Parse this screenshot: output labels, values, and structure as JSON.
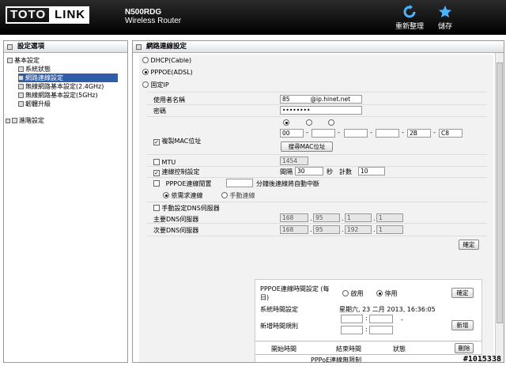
{
  "header": {
    "brand_left": "TOTO",
    "brand_right": "LINK",
    "model": "N500RDG",
    "product": "Wireless Router",
    "reload_label": "重新整理",
    "save_label": "儲存"
  },
  "sidebar": {
    "title": "設定選項",
    "items": [
      {
        "label": "基本設定"
      },
      {
        "label": "系統狀態"
      },
      {
        "label": "網路連線設定"
      },
      {
        "label": "無線網路基本設定(2.4GHz)"
      },
      {
        "label": "無線網路基本設定(5GHz)"
      },
      {
        "label": "韌體升級"
      },
      {
        "label": "進階設定"
      }
    ]
  },
  "main": {
    "title": "網路連線設定",
    "modes": [
      "DHCP(Cable)",
      "PPPOE(ADSL)",
      "固定IP"
    ],
    "username_label": "使用者名稱",
    "username_value": "85",
    "username_suffix": "@ip.hinet.net",
    "password_label": "密碼",
    "password_value": "••••••••",
    "mac_label": "複製MAC位址",
    "mac": [
      "00",
      "",
      "",
      "",
      "2B",
      "C8"
    ],
    "mac_button": "搜尋MAC位址",
    "mtu_label": "MTU",
    "mtu_value": "1454",
    "flow_label": "連線控制設定",
    "interval_label": "間隔",
    "interval_value": "30",
    "sec": "秒",
    "count_label": "計數",
    "count_value": "10",
    "idle_label": "PPPOE連線閒置",
    "idle_suffix": "分鐘後連線將自動中斷",
    "ondemand_label": "依需求連線",
    "manual_label": "手動連線",
    "dns_manual_label": "手動設定DNS伺服器",
    "dns1_label": "主要DNS伺服器",
    "dns1": [
      "168",
      "95",
      "1",
      "1"
    ],
    "dns2_label": "次要DNS伺服器",
    "dns2": [
      "168",
      "95",
      "192",
      "1"
    ],
    "confirm_label": "確定"
  },
  "schedule": {
    "title": "PPPOE連線時間設定 (每日)",
    "enable_label": "啟用",
    "disable_label": "停用",
    "confirm_label": "確定",
    "systime_label": "系統時間設定",
    "systime_value": "星期六, 23 二月 2013, 16:36:05",
    "newrule_label": "新增時間規則",
    "add_label": "新增",
    "col_start": "開始時間",
    "col_end": "結束時間",
    "col_status": "狀態",
    "delete_label": "刪除",
    "empty_text": "PPPoE連線無限制"
  },
  "watermark": "#1015338"
}
